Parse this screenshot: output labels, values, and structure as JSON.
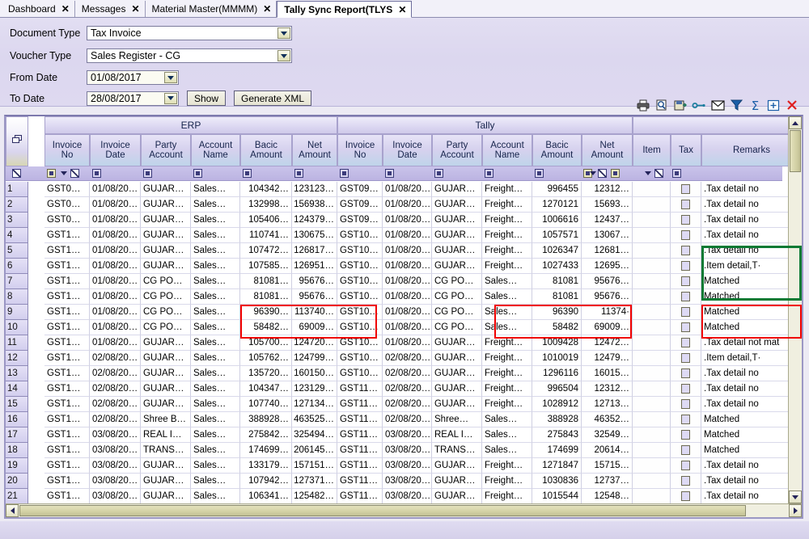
{
  "tabs": [
    {
      "label": "Dashboard",
      "close": "✕",
      "active": false
    },
    {
      "label": "Messages",
      "close": "✕",
      "active": false
    },
    {
      "label": "Material Master(MMMM)",
      "close": "✕",
      "active": false
    },
    {
      "label": "Tally Sync Report(TLYS",
      "close": "✕",
      "active": true
    }
  ],
  "criteria": {
    "document_type_label": "Document Type",
    "document_type_value": "Tax Invoice",
    "voucher_type_label": "Voucher Type",
    "voucher_type_value": "Sales Register - CG",
    "from_date_label": "From Date",
    "from_date_value": "01/08/2017",
    "to_date_label": "To Date",
    "to_date_value": "28/08/2017",
    "show_button": "Show",
    "generate_button": "Generate XML"
  },
  "toolbar": [
    {
      "name": "print-icon",
      "title": "Print"
    },
    {
      "name": "print-preview-icon",
      "title": "Print Preview"
    },
    {
      "name": "save-icon",
      "title": "Save"
    },
    {
      "name": "link-icon",
      "title": "Link"
    },
    {
      "name": "mail-icon",
      "title": "Mail"
    },
    {
      "name": "filter-icon",
      "title": "Filter"
    },
    {
      "name": "sum-icon",
      "title": "Sum"
    },
    {
      "name": "expand-icon",
      "title": "Expand"
    },
    {
      "name": "close-icon",
      "title": "Close"
    }
  ],
  "grid": {
    "groups": [
      {
        "label": "ERP"
      },
      {
        "label": "Tally"
      }
    ],
    "columns": [
      "Invoice\nNo",
      "Invoice\nDate",
      "Party\nAccount",
      "Account\nName",
      "Bacic\nAmount",
      "Net\nAmount",
      "Invoice\nNo",
      "Invoice\nDate",
      "Party\nAccount",
      "Account\nName",
      "Bacic\nAmount",
      "Net\nAmount",
      "Item",
      "Tax",
      "Remarks"
    ],
    "rows": [
      {
        "n": "1",
        "e_inv": "GST0…",
        "e_date": "01/08/20…",
        "e_party": "GUJAR…",
        "e_acct": "Sales…",
        "e_basic": "104342…",
        "e_net": "123123…",
        "t_inv": "GST09…",
        "t_date": "01/08/20…",
        "t_party": "GUJAR…",
        "t_acct": "Freight…",
        "t_basic": "996455",
        "t_net": "12312…",
        "remark": ".Tax detail no"
      },
      {
        "n": "2",
        "e_inv": "GST0…",
        "e_date": "01/08/20…",
        "e_party": "GUJAR…",
        "e_acct": "Sales…",
        "e_basic": "132998…",
        "e_net": "156938…",
        "t_inv": "GST09…",
        "t_date": "01/08/20…",
        "t_party": "GUJAR…",
        "t_acct": "Freight…",
        "t_basic": "1270121",
        "t_net": "15693…",
        "remark": ".Tax detail no"
      },
      {
        "n": "3",
        "e_inv": "GST0…",
        "e_date": "01/08/20…",
        "e_party": "GUJAR…",
        "e_acct": "Sales…",
        "e_basic": "105406…",
        "e_net": "124379…",
        "t_inv": "GST09…",
        "t_date": "01/08/20…",
        "t_party": "GUJAR…",
        "t_acct": "Freight…",
        "t_basic": "1006616",
        "t_net": "12437…",
        "remark": ".Tax detail no"
      },
      {
        "n": "4",
        "e_inv": "GST1…",
        "e_date": "01/08/20…",
        "e_party": "GUJAR…",
        "e_acct": "Sales…",
        "e_basic": "110741…",
        "e_net": "130675…",
        "t_inv": "GST10…",
        "t_date": "01/08/20…",
        "t_party": "GUJAR…",
        "t_acct": "Freight…",
        "t_basic": "1057571",
        "t_net": "13067…",
        "remark": ".Tax detail no"
      },
      {
        "n": "5",
        "e_inv": "GST1…",
        "e_date": "01/08/20…",
        "e_party": "GUJAR…",
        "e_acct": "Sales…",
        "e_basic": "107472…",
        "e_net": "126817…",
        "t_inv": "GST10…",
        "t_date": "01/08/20…",
        "t_party": "GUJAR…",
        "t_acct": "Freight…",
        "t_basic": "1026347",
        "t_net": "12681…",
        "remark": ".Tax detail no"
      },
      {
        "n": "6",
        "e_inv": "GST1…",
        "e_date": "01/08/20…",
        "e_party": "GUJAR…",
        "e_acct": "Sales…",
        "e_basic": "107585…",
        "e_net": "126951…",
        "t_inv": "GST10…",
        "t_date": "01/08/20…",
        "t_party": "GUJAR…",
        "t_acct": "Freight…",
        "t_basic": "1027433",
        "t_net": "12695…",
        "remark": ".Item  detail,T·"
      },
      {
        "n": "7",
        "e_inv": "GST1…",
        "e_date": "01/08/20…",
        "e_party": "CG PO…",
        "e_acct": "Sales…",
        "e_basic": "81081…",
        "e_net": "95676…",
        "t_inv": "GST10…",
        "t_date": "01/08/20…",
        "t_party": "CG PO…",
        "t_acct": "Sales…",
        "t_basic": "81081",
        "t_net": "95676…",
        "remark": "Matched"
      },
      {
        "n": "8",
        "e_inv": "GST1…",
        "e_date": "01/08/20…",
        "e_party": "CG PO…",
        "e_acct": "Sales…",
        "e_basic": "81081…",
        "e_net": "95676…",
        "t_inv": "GST10…",
        "t_date": "01/08/20…",
        "t_party": "CG PO…",
        "t_acct": "Sales…",
        "t_basic": "81081",
        "t_net": "95676…",
        "remark": "Matched"
      },
      {
        "n": "9",
        "e_inv": "GST1…",
        "e_date": "01/08/20…",
        "e_party": "CG PO…",
        "e_acct": "Sales…",
        "e_basic": "96390…",
        "e_net": "113740…",
        "t_inv": "GST10…",
        "t_date": "01/08/20…",
        "t_party": "CG PO…",
        "t_acct": "Sales…",
        "t_basic": "96390",
        "t_net": "11374·",
        "remark": "Matched"
      },
      {
        "n": "10",
        "e_inv": "GST1…",
        "e_date": "01/08/20…",
        "e_party": "CG PO…",
        "e_acct": "Sales…",
        "e_basic": "58482…",
        "e_net": "69009…",
        "t_inv": "GST10…",
        "t_date": "01/08/20…",
        "t_party": "CG PO…",
        "t_acct": "Sales…",
        "t_basic": "58482",
        "t_net": "69009…",
        "remark": "Matched"
      },
      {
        "n": "11",
        "e_inv": "GST1…",
        "e_date": "01/08/20…",
        "e_party": "GUJAR…",
        "e_acct": "Sales…",
        "e_basic": "105700…",
        "e_net": "124720…",
        "t_inv": "GST10…",
        "t_date": "01/08/20…",
        "t_party": "GUJAR…",
        "t_acct": "Freight…",
        "t_basic": "1009428",
        "t_net": "12472…",
        "remark": ".Tax detail not mat"
      },
      {
        "n": "12",
        "e_inv": "GST1…",
        "e_date": "02/08/20…",
        "e_party": "GUJAR…",
        "e_acct": "Sales…",
        "e_basic": "105762…",
        "e_net": "124799…",
        "t_inv": "GST10…",
        "t_date": "02/08/20…",
        "t_party": "GUJAR…",
        "t_acct": "Freight…",
        "t_basic": "1010019",
        "t_net": "12479…",
        "remark": ".Item  detail,T·"
      },
      {
        "n": "13",
        "e_inv": "GST1…",
        "e_date": "02/08/20…",
        "e_party": "GUJAR…",
        "e_acct": "Sales…",
        "e_basic": "135720…",
        "e_net": "160150…",
        "t_inv": "GST10…",
        "t_date": "02/08/20…",
        "t_party": "GUJAR…",
        "t_acct": "Freight…",
        "t_basic": "1296116",
        "t_net": "16015…",
        "remark": ".Tax detail no"
      },
      {
        "n": "14",
        "e_inv": "GST1…",
        "e_date": "02/08/20…",
        "e_party": "GUJAR…",
        "e_acct": "Sales…",
        "e_basic": "104347…",
        "e_net": "123129…",
        "t_inv": "GST11…",
        "t_date": "02/08/20…",
        "t_party": "GUJAR…",
        "t_acct": "Freight…",
        "t_basic": "996504",
        "t_net": "12312…",
        "remark": ".Tax detail no"
      },
      {
        "n": "15",
        "e_inv": "GST1…",
        "e_date": "02/08/20…",
        "e_party": "GUJAR…",
        "e_acct": "Sales…",
        "e_basic": "107740…",
        "e_net": "127134…",
        "t_inv": "GST11…",
        "t_date": "02/08/20…",
        "t_party": "GUJAR…",
        "t_acct": "Freight…",
        "t_basic": "1028912",
        "t_net": "12713…",
        "remark": ".Tax detail no"
      },
      {
        "n": "16",
        "e_inv": "GST1…",
        "e_date": "02/08/20…",
        "e_party": "Shree B…",
        "e_acct": "Sales…",
        "e_basic": "388928…",
        "e_net": "463525…",
        "t_inv": "GST11…",
        "t_date": "02/08/20…",
        "t_party": "Shree…",
        "t_acct": "Sales…",
        "t_basic": "388928",
        "t_net": "46352…",
        "remark": "Matched"
      },
      {
        "n": "17",
        "e_inv": "GST1…",
        "e_date": "03/08/20…",
        "e_party": "REAL I…",
        "e_acct": "Sales…",
        "e_basic": "275842…",
        "e_net": "325494…",
        "t_inv": "GST11…",
        "t_date": "03/08/20…",
        "t_party": "REAL I…",
        "t_acct": "Sales…",
        "t_basic": "275843",
        "t_net": "32549…",
        "remark": "Matched"
      },
      {
        "n": "18",
        "e_inv": "GST1…",
        "e_date": "03/08/20…",
        "e_party": "TRANS…",
        "e_acct": "Sales…",
        "e_basic": "174699…",
        "e_net": "206145…",
        "t_inv": "GST11…",
        "t_date": "03/08/20…",
        "t_party": "TRANS…",
        "t_acct": "Sales…",
        "t_basic": "174699",
        "t_net": "20614…",
        "remark": "Matched"
      },
      {
        "n": "19",
        "e_inv": "GST1…",
        "e_date": "03/08/20…",
        "e_party": "GUJAR…",
        "e_acct": "Sales…",
        "e_basic": "133179…",
        "e_net": "157151…",
        "t_inv": "GST11…",
        "t_date": "03/08/20…",
        "t_party": "GUJAR…",
        "t_acct": "Freight…",
        "t_basic": "1271847",
        "t_net": "15715…",
        "remark": ".Tax detail no"
      },
      {
        "n": "20",
        "e_inv": "GST1…",
        "e_date": "03/08/20…",
        "e_party": "GUJAR…",
        "e_acct": "Sales…",
        "e_basic": "107942…",
        "e_net": "127371…",
        "t_inv": "GST11…",
        "t_date": "03/08/20…",
        "t_party": "GUJAR…",
        "t_acct": "Freight…",
        "t_basic": "1030836",
        "t_net": "12737…",
        "remark": ".Tax detail no"
      },
      {
        "n": "21",
        "e_inv": "GST1…",
        "e_date": "03/08/20…",
        "e_party": "GUJAR…",
        "e_acct": "Sales…",
        "e_basic": "106341…",
        "e_net": "125482…",
        "t_inv": "GST11…",
        "t_date": "03/08/20…",
        "t_party": "GUJAR…",
        "t_acct": "Freight…",
        "t_basic": "1015544",
        "t_net": "12548…",
        "remark": ".Tax detail no"
      }
    ]
  },
  "annotations": {
    "red_color": "#f00000",
    "green_color": "#0a7a34"
  }
}
